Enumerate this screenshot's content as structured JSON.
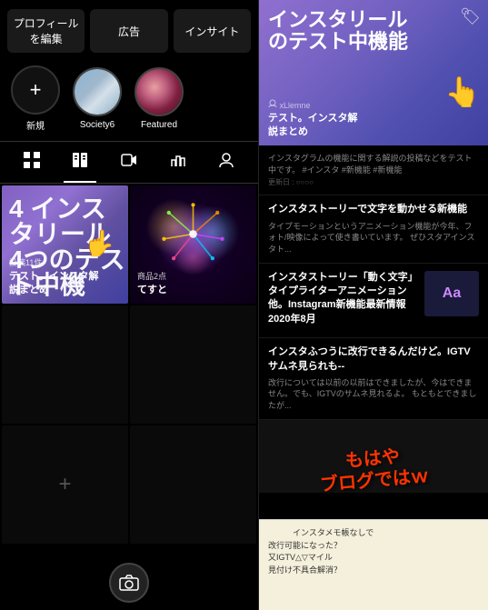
{
  "left": {
    "buttons": {
      "edit": "プロフィールを編集",
      "ads": "広告",
      "insights": "インサイト"
    },
    "highlights": [
      {
        "id": "new",
        "label": "新規",
        "type": "new"
      },
      {
        "id": "society6",
        "label": "Society6",
        "type": "avatar-society6"
      },
      {
        "id": "featured",
        "label": "Featured",
        "type": "avatar-featured"
      }
    ],
    "nav": {
      "grid_icon": "⊞",
      "book_icon": "📖",
      "play_icon": "▷",
      "chart_icon": "📈",
      "person_icon": "👤"
    },
    "cards": [
      {
        "id": "purple-card",
        "type": "featured",
        "large_text": "4 インスタリール\n4つのテスト中機",
        "count": "投稿11件",
        "title": "テスト。インスタ解\n説まとめ"
      },
      {
        "id": "fireworks-card",
        "type": "fireworks",
        "count": "商品2点",
        "title": "てすと"
      }
    ],
    "empty_card": {
      "plus": "+"
    }
  },
  "right": {
    "top_card": {
      "large_text": "インスタリール\nのテスト中機能",
      "tag_icon": "🏷",
      "author": "xLlemne",
      "subtitle": "テスト。インスタ解\n説まとめ"
    },
    "articles": [
      {
        "id": "art1",
        "title": "インスタグラムの機能に関する解説の投稿などをテスト中です。 #インスタ #新機能 #新機能",
        "body": "更新日 : ○○○○",
        "has_image": false
      },
      {
        "id": "art2",
        "title": "インスタストーリーで文字を動かせる新機能",
        "body": "タイプモーションというアニメーション機能が今年、フォト/映像によって使き書いています。 ぜひスタアインスタト...",
        "has_image": false
      },
      {
        "id": "art3",
        "title": "インスタストーリー「動く文字」タイプライターアニメーション他。Instagram新機能最新情報2020年8月",
        "body": "",
        "has_image": true,
        "image_type": "aa"
      },
      {
        "id": "art4",
        "title": "インスタふつうに改行できるんだけど。IGTVサムネ見られも--",
        "body": "改行については以前の以前はできましたが、今はできません。でも、IGTVのサムネ見れるよ。 もともとできましたが...",
        "has_image": false
      }
    ],
    "handwriting": "もはや\nブログではｗ",
    "memo": {
      "text": "　　　インスタメモ帳なしで\n改行可能になった？\n又IGTV△▽マイル\n見付け不具合解消？"
    }
  }
}
